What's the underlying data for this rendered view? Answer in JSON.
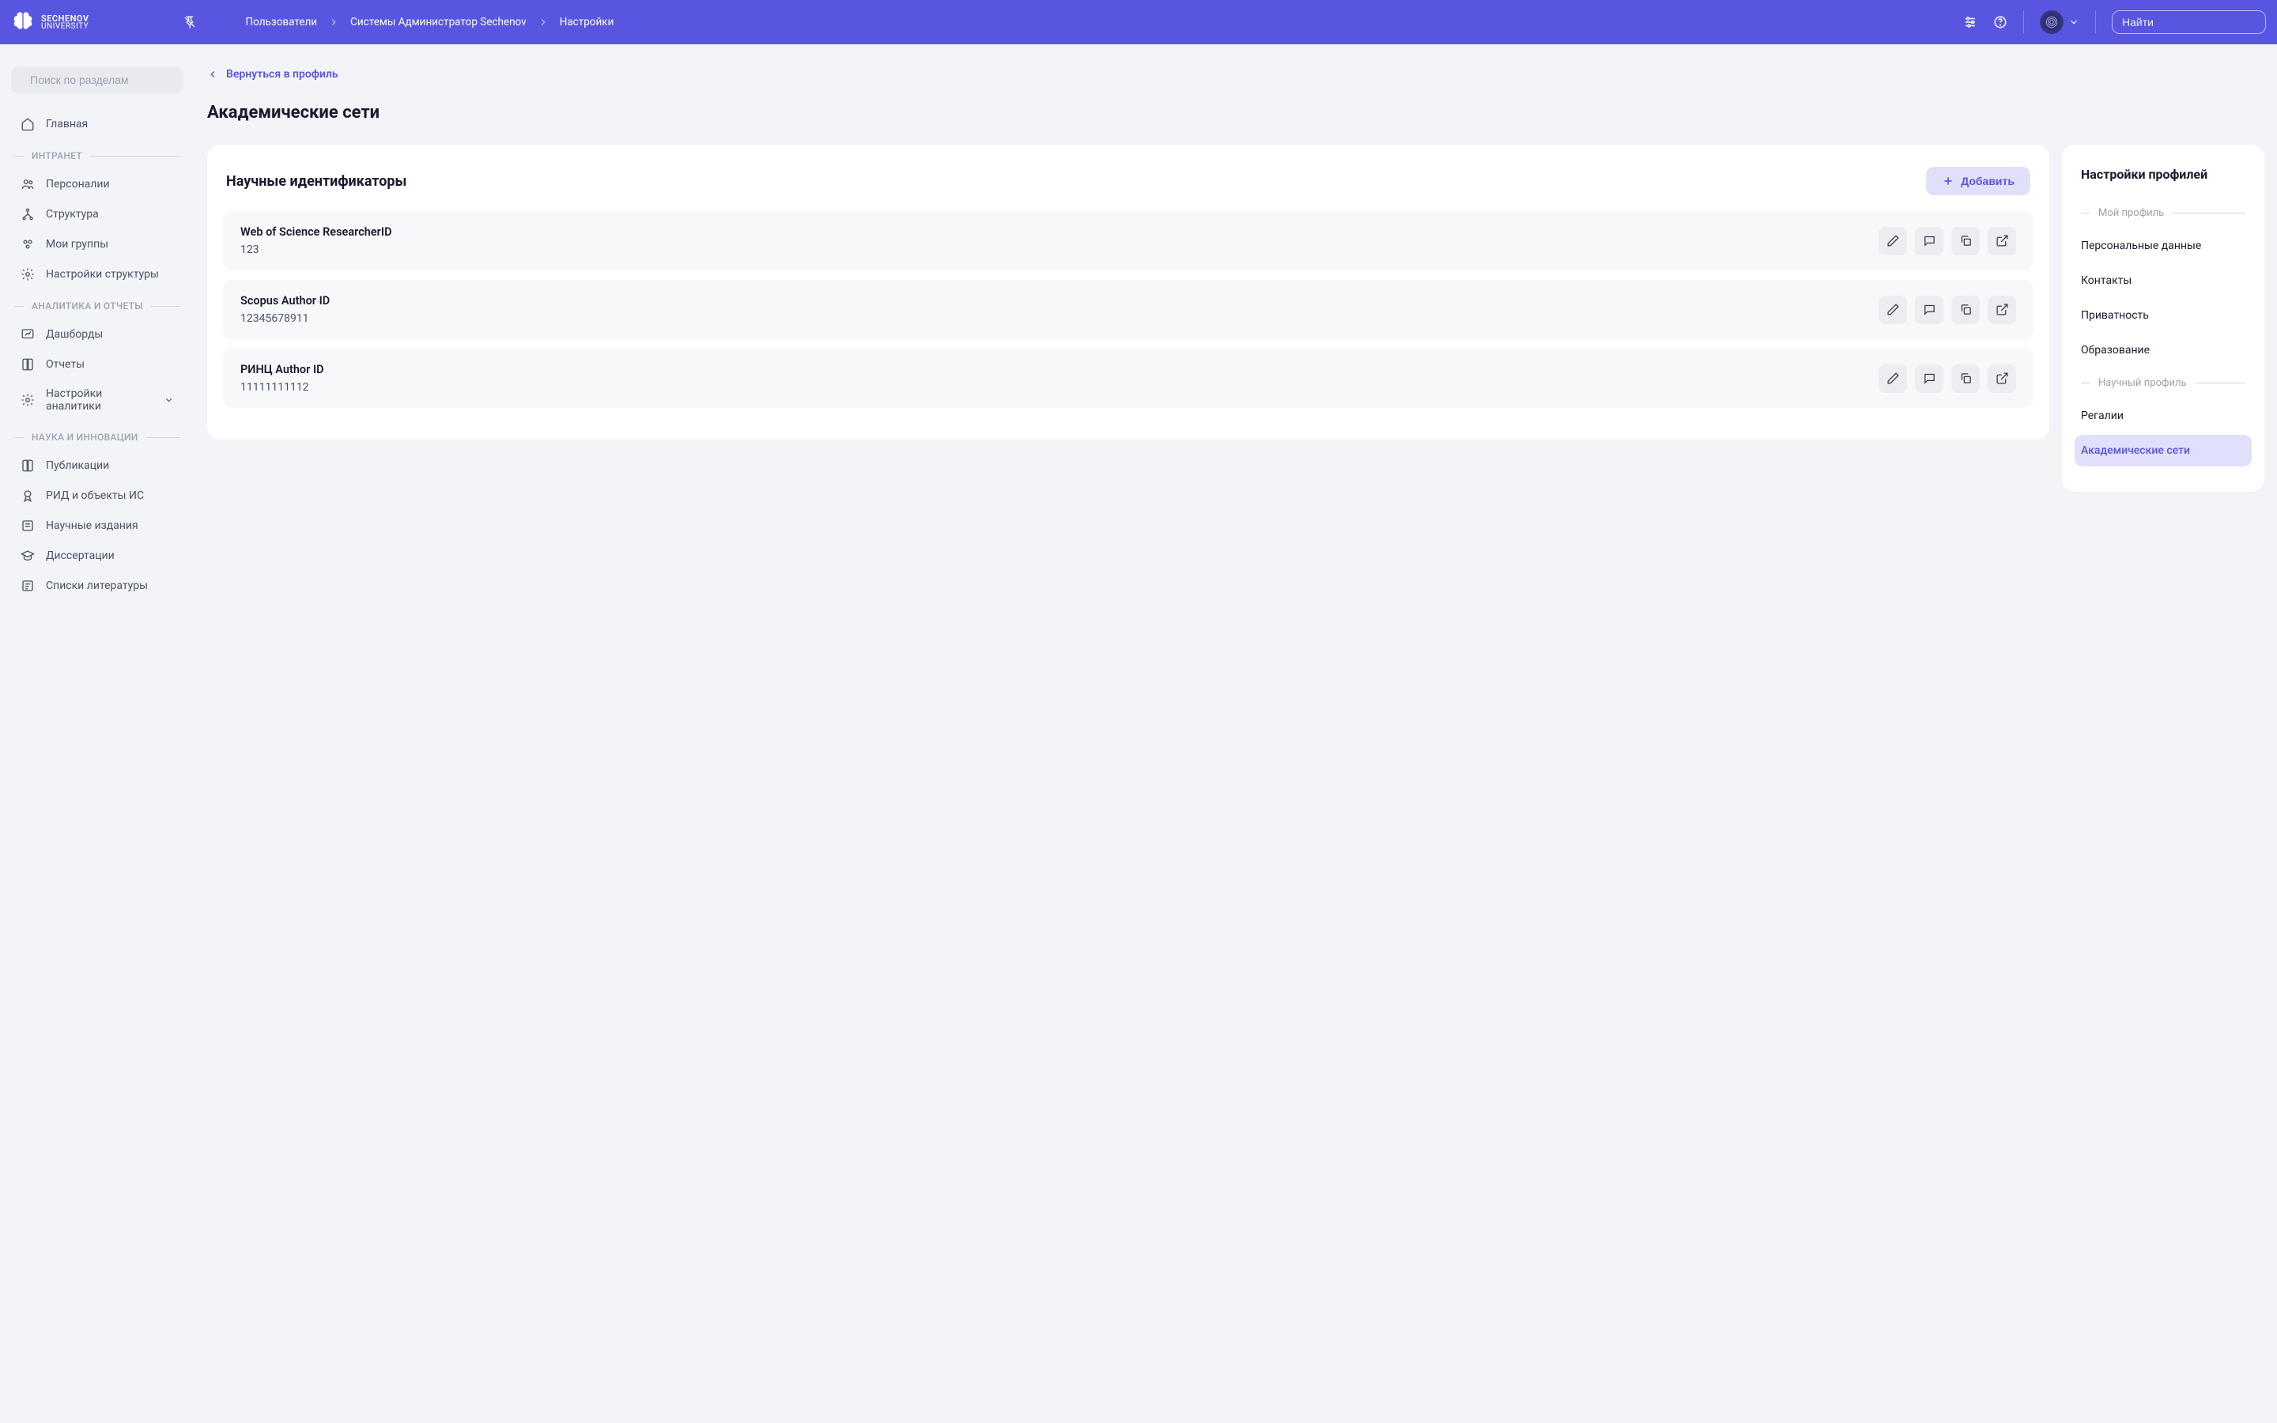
{
  "header": {
    "logo_line1": "SECHENOV",
    "logo_line2": "UNIVERSITY",
    "breadcrumb": [
      "Пользователи",
      "Системы Администратор Sechenov",
      "Настройки"
    ],
    "search_placeholder": "Найти"
  },
  "sidebar": {
    "search_placeholder": "Поиск по разделам",
    "home": "Главная",
    "sections": [
      {
        "title": "ИНТРАНЕТ",
        "items": [
          "Персоналии",
          "Структура",
          "Мои группы",
          "Настройки структуры"
        ]
      },
      {
        "title": "АНАЛИТИКА И ОТЧЕТЫ",
        "items": [
          "Дашборды",
          "Отчеты",
          "Настройки аналитики"
        ]
      },
      {
        "title": "НАУКА И ИННОВАЦИИ",
        "items": [
          "Публикации",
          "РИД и объекты ИС",
          "Научные издания",
          "Диссертации",
          "Списки литературы"
        ]
      }
    ]
  },
  "main": {
    "back_label": "Вернуться в профиль",
    "page_title": "Академические сети",
    "card_title": "Научные идентификаторы",
    "add_label": "Добавить",
    "identifiers": [
      {
        "label": "Web of Science ResearcherID",
        "value": "123"
      },
      {
        "label": "Scopus Author ID",
        "value": "12345678911"
      },
      {
        "label": "РИНЦ Author ID",
        "value": "11111111112"
      }
    ]
  },
  "rightPanel": {
    "title": "Настройки профилей",
    "section1": "Мой профиль",
    "links1": [
      "Персональные данные",
      "Контакты",
      "Приватность",
      "Образование"
    ],
    "section2": "Научный профиль",
    "links2": [
      "Регалии",
      "Академические сети"
    ]
  }
}
